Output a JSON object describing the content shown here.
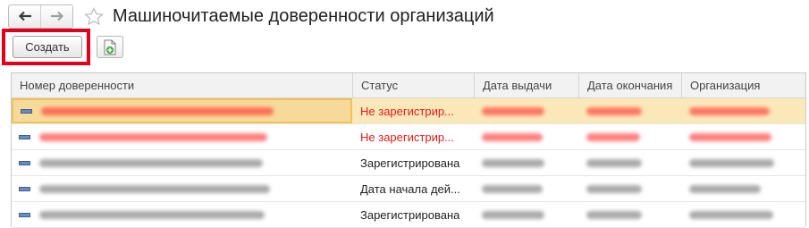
{
  "nav": {
    "back_icon": "arrow-left-icon",
    "forward_icon": "arrow-right-icon",
    "favorite_icon": "star-icon"
  },
  "title": "Машиночитаемые доверенности организаций",
  "toolbar": {
    "create_label": "Создать",
    "add_icon": "document-add-icon"
  },
  "colors": {
    "highlight": "#e0001b",
    "selected_row": "#fbe8b9",
    "error_text": "#e31919"
  },
  "table": {
    "columns": [
      "Номер доверенности",
      "Статус",
      "Дата выдачи",
      "Дата окончания",
      "Организация"
    ],
    "rows": [
      {
        "status": "Не зарегистрир...",
        "state": "error",
        "selected": true
      },
      {
        "status": "Не зарегистрир...",
        "state": "error",
        "selected": false
      },
      {
        "status": "Зарегистрирована",
        "state": "ok",
        "selected": false
      },
      {
        "status": "Дата начала дей...",
        "state": "ok",
        "selected": false
      },
      {
        "status": "Зарегистрирована",
        "state": "ok",
        "selected": false
      }
    ]
  }
}
